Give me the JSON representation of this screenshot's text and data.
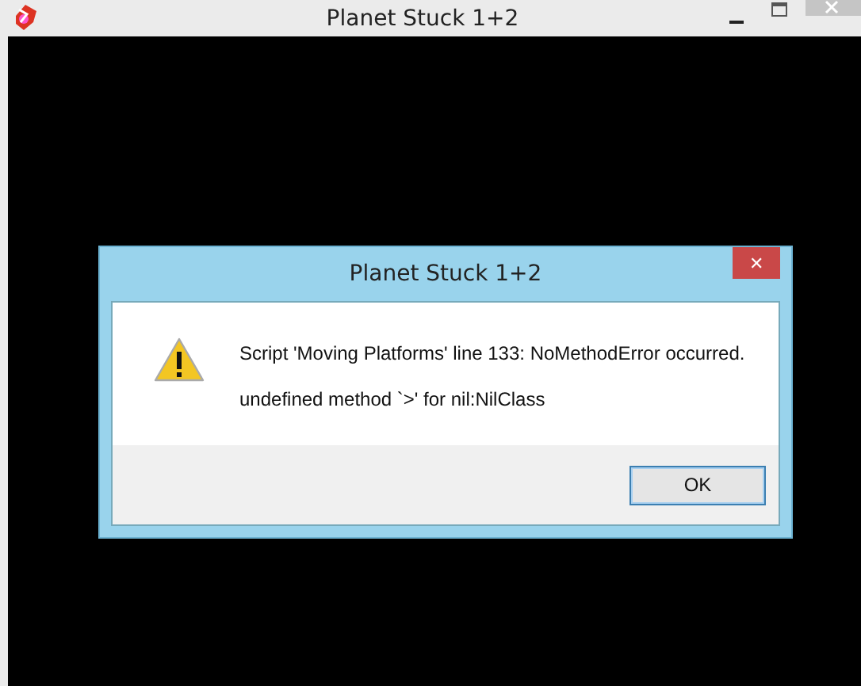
{
  "window": {
    "title": "Planet Stuck 1+2"
  },
  "dialog": {
    "title": "Planet Stuck 1+2",
    "close": "✕",
    "message": "Script 'Moving Platforms' line 133: NoMethodError occurred.",
    "detail": "undefined method `>' for nil:NilClass",
    "buttons": [
      "OK"
    ]
  }
}
